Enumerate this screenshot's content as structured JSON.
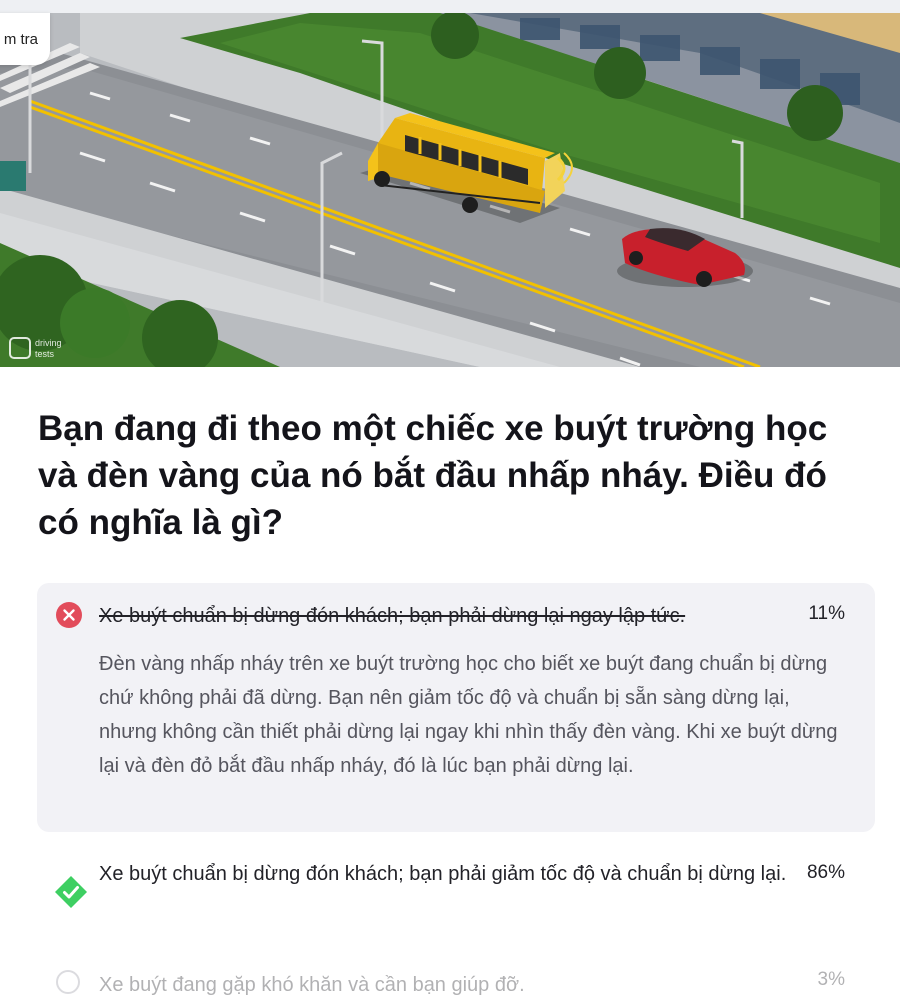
{
  "header": {
    "chip_label": "m tra"
  },
  "scene": {
    "watermark_line1": "driving",
    "watermark_line2": "tests",
    "colors": {
      "bus": "#f4c21a",
      "car": "#c8202c",
      "grass": "#3f7a2a",
      "road": "#8c8f94",
      "center_line": "#f2c100"
    }
  },
  "question": {
    "text": "Bạn đang đi theo một chiếc xe buýt trường học và đèn vàng của nó bắt đầu nhấp nháy. Điều đó có nghĩa là gì?"
  },
  "options": [
    {
      "status": "wrong",
      "text": "Xe buýt chuẩn bị dừng đón khách; bạn phải dừng lại ngay lập tức.",
      "percent": "11%",
      "explanation": "Đèn vàng nhấp nháy trên xe buýt trường học cho biết xe buýt đang chuẩn bị dừng chứ không phải đã dừng. Bạn nên giảm tốc độ và chuẩn bị sẵn sàng dừng lại, nhưng không cần thiết phải dừng lại ngay khi nhìn thấy đèn vàng. Khi xe buýt dừng lại và đèn đỏ bắt đầu nhấp nháy, đó là lúc bạn phải dừng lại."
    },
    {
      "status": "correct",
      "text": "Xe buýt chuẩn bị dừng đón khách; bạn phải giảm tốc độ và chuẩn bị dừng lại.",
      "percent": "86%"
    },
    {
      "status": "neutral",
      "text": "Xe buýt đang gặp khó khăn và cần bạn giúp đỡ.",
      "percent": "3%"
    }
  ],
  "colors": {
    "wrong": "#e24c5b",
    "correct": "#3ecf62",
    "card_bg": "#f2f2f6"
  }
}
